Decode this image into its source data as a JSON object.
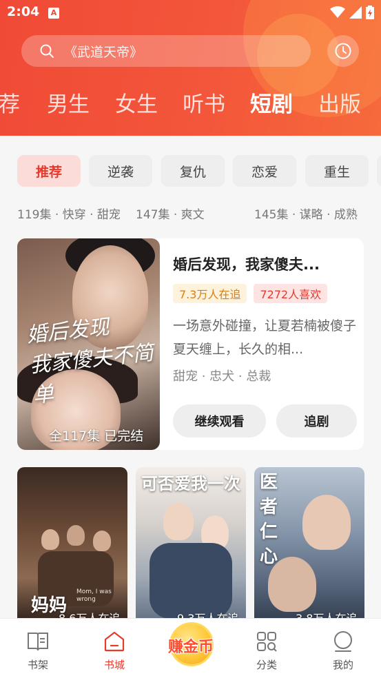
{
  "status_bar": {
    "time": "2:04",
    "notification_glyph": "A"
  },
  "search": {
    "placeholder": "《武道天帝》"
  },
  "top_tabs": [
    {
      "label": "荐"
    },
    {
      "label": "男生"
    },
    {
      "label": "女生"
    },
    {
      "label": "听书"
    },
    {
      "label": "短剧",
      "active": true
    },
    {
      "label": "出版"
    }
  ],
  "filter_chips": [
    {
      "label": "推荐",
      "active": true
    },
    {
      "label": "逆袭"
    },
    {
      "label": "复仇"
    },
    {
      "label": "恋爱"
    },
    {
      "label": "重生"
    }
  ],
  "sub_info": [
    "119集 · 快穿 · 甜宠",
    "147集 · 爽文",
    "145集 · 谋略 · 成熟"
  ],
  "featured": {
    "poster_text_line1": "婚后发现",
    "poster_text_line2": "我家傻夫不简单",
    "episodes": "全117集  已完结",
    "title": "婚后发现，我家傻夫...",
    "followers": "7.3万人在追",
    "likes": "7272人喜欢",
    "description": "一场意外碰撞，让夏若楠被傻子夏天缠上，长久的相...",
    "tags": "甜宠 · 忠犬 · 总裁",
    "continue_label": "继续观看",
    "follow_label": "追剧"
  },
  "cards": [
    {
      "title": "妈妈",
      "overlay_text": "Mom, I was wrong",
      "watching": "8.6万人在追"
    },
    {
      "title": "可否爱我一次",
      "watching": "9.3万人在追"
    },
    {
      "title": "医者仁心",
      "watching": "3.8万人在追"
    }
  ],
  "bottom_nav": {
    "bookshelf": "书架",
    "bookstore": "书城",
    "earn": "赚金币",
    "category": "分类",
    "mine": "我的"
  },
  "colors": {
    "accent": "#e8392d",
    "header": "#f04a36",
    "gold": "#ffc93a"
  }
}
